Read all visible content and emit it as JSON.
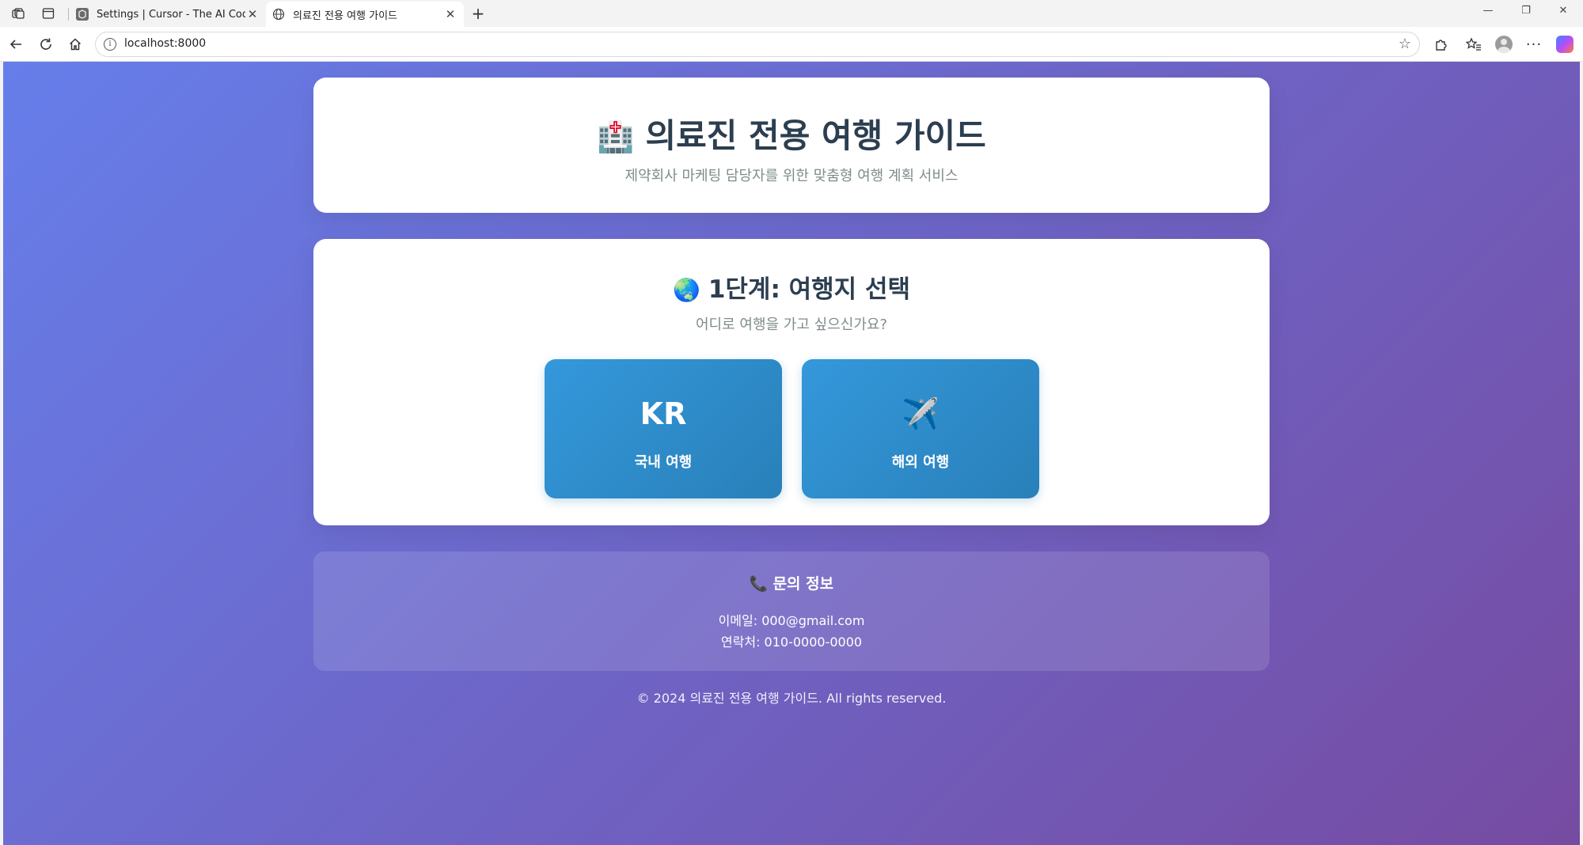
{
  "browser": {
    "tabs": [
      {
        "title": "Settings | Cursor - The AI Code Ed",
        "active": false
      },
      {
        "title": "의료진 전용 여행 가이드",
        "active": true
      }
    ],
    "url": "localhost:8000",
    "icons": {
      "workspaces": "workspaces-icon",
      "tab_actions": "tab-actions-icon",
      "back": "back-arrow-icon",
      "refresh": "refresh-icon",
      "home": "home-icon",
      "favorite": "star-icon",
      "extensions": "puzzle-icon",
      "favorites_list": "favorites-icon",
      "profile": "profile-icon",
      "more": "ellipsis-icon",
      "copilot": "copilot-icon"
    }
  },
  "page": {
    "header": {
      "emoji": "🏥",
      "title": "의료진 전용 여행 가이드",
      "subtitle": "제약회사 마케팅 담당자를 위한 맞춤형 여행 계획 서비스"
    },
    "step": {
      "emoji": "🌏",
      "title": "1단계: 여행지 선택",
      "subtitle": "어디로 여행을 가고 싶으신가요?",
      "options": [
        {
          "icon_text": "KR",
          "label": "국내 여행"
        },
        {
          "icon_text": "✈️",
          "label": "해외 여행"
        }
      ]
    },
    "contact": {
      "emoji": "📞",
      "title": "문의 정보",
      "email": "이메일: 000@gmail.com",
      "phone": "연락처: 010-0000-0000"
    },
    "footer": "© 2024 의료진 전용 여행 가이드. All rights reserved."
  },
  "colors": {
    "gradient_start": "#667eea",
    "gradient_end": "#764ba2",
    "button_start": "#3498db",
    "button_end": "#2980b9",
    "title": "#2c3e50",
    "muted": "#7f8c8d"
  }
}
